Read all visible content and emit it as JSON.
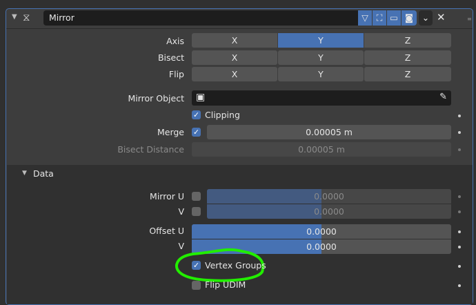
{
  "modifier": {
    "name": "Mirror"
  },
  "axis": {
    "label": "Axis",
    "options": [
      "X",
      "Y",
      "Z"
    ],
    "selected": "Y"
  },
  "bisect": {
    "label": "Bisect",
    "options": [
      "X",
      "Y",
      "Z"
    ]
  },
  "flip": {
    "label": "Flip",
    "options": [
      "X",
      "Y",
      "Z"
    ]
  },
  "mirror_object": {
    "label": "Mirror Object"
  },
  "clipping": {
    "label": "Clipping",
    "checked": true
  },
  "merge": {
    "label": "Merge",
    "checked": true,
    "value": "0.00005 m"
  },
  "bisect_distance": {
    "label": "Bisect Distance",
    "value": "0.00005 m"
  },
  "data": {
    "title": "Data",
    "mirror_u": {
      "label": "Mirror U",
      "value": "0.0000",
      "fill": 0.5
    },
    "mirror_v": {
      "label": "V",
      "value": "0.0000",
      "fill": 0.5
    },
    "offset_u": {
      "label": "Offset U",
      "value": "0.0000",
      "fill": 0.5
    },
    "offset_v": {
      "label": "V",
      "value": "0.0000",
      "fill": 0.5
    },
    "vertex_groups": {
      "label": "Vertex Groups",
      "checked": true
    },
    "flip_udim": {
      "label": "Flip UDIM",
      "checked": false
    }
  },
  "colors": {
    "accent": "#4772b3",
    "annotation": "#22ee00"
  }
}
